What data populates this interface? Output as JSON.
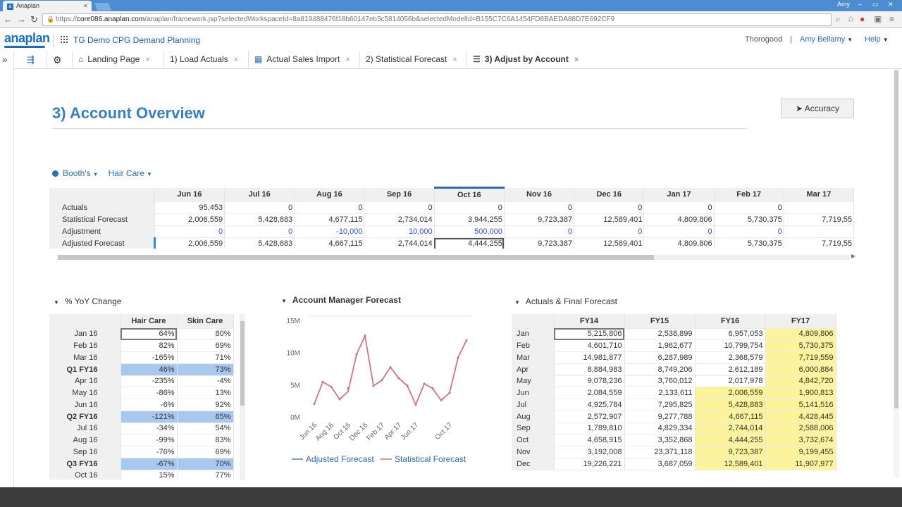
{
  "browser": {
    "tab_title": "Anaplan",
    "tab_close": "×",
    "user": "Amy",
    "win_min": "–",
    "win_max": "▭",
    "win_close": "✕",
    "url_scheme": "https://",
    "url_host": "core086.anaplan.com",
    "url_rest": "/anaplan/framework.jsp?selectedWorkspaceId=8a819488476f18b60147eb3c5814056b&selectedModelId=B155C7C6A1454FD8BAEDA88D7E692CF9"
  },
  "app": {
    "logo": "anaplan",
    "model_name": "TG Demo CPG Demand Planning",
    "workspace": "Thorogood",
    "separator": "|",
    "user": "Amy Bellamy",
    "help": "Help",
    "side_toggle": "»"
  },
  "tabs": [
    {
      "label": "Landing Page",
      "close": "×"
    },
    {
      "label": "1) Load Actuals",
      "close": "×"
    },
    {
      "label": "Actual Sales Import",
      "close": "×"
    },
    {
      "label": "2) Statistical Forecast",
      "close": "×"
    },
    {
      "label": "3) Adjust by Account",
      "close": "×"
    }
  ],
  "page": {
    "title": "3) Account Overview",
    "accuracy_button": "Accuracy"
  },
  "filters": {
    "account": "Booth's",
    "category": "Hair Care"
  },
  "main_grid": {
    "columns": [
      "Jun 16",
      "Jul 16",
      "Aug 16",
      "Sep 16",
      "Oct 16",
      "Nov 16",
      "Dec 16",
      "Jan 17",
      "Feb 17",
      "Mar 17"
    ],
    "rows": [
      {
        "label": "Actuals",
        "values": [
          "95,453",
          "0",
          "0",
          "0",
          "0",
          "0",
          "0",
          "0",
          "0",
          ""
        ]
      },
      {
        "label": "Statistical Forecast",
        "values": [
          "2,006,559",
          "5,428,883",
          "4,677,115",
          "2,734,014",
          "3,944,255",
          "9,723,387",
          "12,589,401",
          "4,809,806",
          "5,730,375",
          "7,719,55"
        ]
      },
      {
        "label": "Adjustment",
        "values": [
          "0",
          "0",
          "-10,000",
          "10,000",
          "500,000",
          "0",
          "0",
          "0",
          "0",
          ""
        ]
      },
      {
        "label": "Adjusted Forecast",
        "values": [
          "2,006,559",
          "5,428,883",
          "4,667,115",
          "2,744,014",
          "4,444,255",
          "9,723,387",
          "12,589,401",
          "4,809,806",
          "5,730,375",
          "7,719,55"
        ]
      }
    ]
  },
  "yoy": {
    "title": "% YoY Change",
    "columns": [
      "Hair Care",
      "Skin Care"
    ],
    "rows": [
      {
        "label": "Jan 16",
        "values": [
          "64%",
          "80%"
        ],
        "q": false
      },
      {
        "label": "Feb 16",
        "values": [
          "82%",
          "69%"
        ],
        "q": false
      },
      {
        "label": "Mar 16",
        "values": [
          "-165%",
          "71%"
        ],
        "q": false
      },
      {
        "label": "Q1 FY16",
        "values": [
          "46%",
          "73%"
        ],
        "q": true
      },
      {
        "label": "Apr 16",
        "values": [
          "-235%",
          "-4%"
        ],
        "q": false
      },
      {
        "label": "May 16",
        "values": [
          "-86%",
          "13%"
        ],
        "q": false
      },
      {
        "label": "Jun 16",
        "values": [
          "-6%",
          "92%"
        ],
        "q": false
      },
      {
        "label": "Q2 FY16",
        "values": [
          "-121%",
          "65%"
        ],
        "q": true
      },
      {
        "label": "Jul 16",
        "values": [
          "-34%",
          "54%"
        ],
        "q": false
      },
      {
        "label": "Aug 16",
        "values": [
          "-99%",
          "83%"
        ],
        "q": false
      },
      {
        "label": "Sep 16",
        "values": [
          "-76%",
          "69%"
        ],
        "q": false
      },
      {
        "label": "Q3 FY16",
        "values": [
          "-67%",
          "70%"
        ],
        "q": true
      },
      {
        "label": "Oct 16",
        "values": [
          "15%",
          "77%"
        ],
        "q": false
      }
    ]
  },
  "chart_title": "Account Manager Forecast",
  "chart_data": {
    "type": "line",
    "title": "Account Manager Forecast",
    "x": [
      "Jun 16",
      "Jul 16",
      "Aug 16",
      "Sep 16",
      "Oct 16",
      "Nov 16",
      "Dec 16",
      "Jan 17",
      "Feb 17",
      "Mar 17",
      "Apr 17",
      "May 17",
      "Jun 17",
      "Jul 17",
      "Aug 17",
      "Sep 17",
      "Oct 17",
      "Nov 17",
      "Dec 17"
    ],
    "x_tick_labels": [
      "Jun 16",
      "Aug 16",
      "Oct 16",
      "Dec 16",
      "Feb 17",
      "Apr 17",
      "Jun 17",
      "Oct 17"
    ],
    "y_tick_labels": [
      "15M",
      "10M",
      "5M",
      "0M"
    ],
    "ylim": [
      0,
      15000000
    ],
    "series": [
      {
        "name": "Adjusted Forecast",
        "color": "#5b7fb4",
        "values": [
          2006559,
          5428883,
          4667115,
          2744014,
          4444255,
          9723387,
          12589401,
          4809806,
          5730375,
          7719559,
          6000884,
          4842720,
          1900813,
          5141516,
          4428445,
          2588006,
          3732674,
          9199455,
          11907977
        ],
        "line": false
      },
      {
        "name": "Statistical Forecast",
        "color": "#d0767e",
        "values": [
          2006559,
          5428883,
          4677115,
          2734014,
          3944255,
          9723387,
          12589401,
          4809806,
          5730375,
          7719559,
          6000884,
          4842720,
          1900813,
          5141516,
          4428445,
          2588006,
          3732674,
          9199455,
          11907977
        ],
        "line": true
      }
    ]
  },
  "af": {
    "title": "Actuals & Final Forecast",
    "columns": [
      "FY14",
      "FY15",
      "FY16",
      "FY17"
    ],
    "rows": [
      {
        "label": "Jan",
        "values": [
          "5,215,806",
          "2,538,899",
          "6,957,053",
          "4,809,806"
        ],
        "yel": [
          false,
          false,
          false,
          true
        ]
      },
      {
        "label": "Feb",
        "values": [
          "4,601,710",
          "1,962,677",
          "10,799,754",
          "5,730,375"
        ],
        "yel": [
          false,
          false,
          false,
          true
        ]
      },
      {
        "label": "Mar",
        "values": [
          "14,981,877",
          "6,287,989",
          "2,368,579",
          "7,719,559"
        ],
        "yel": [
          false,
          false,
          false,
          true
        ]
      },
      {
        "label": "Apr",
        "values": [
          "8,884,983",
          "8,749,206",
          "2,612,189",
          "6,000,884"
        ],
        "yel": [
          false,
          false,
          false,
          true
        ]
      },
      {
        "label": "May",
        "values": [
          "9,078,236",
          "3,760,012",
          "2,017,978",
          "4,842,720"
        ],
        "yel": [
          false,
          false,
          false,
          true
        ]
      },
      {
        "label": "Jun",
        "values": [
          "2,084,559",
          "2,133,611",
          "2,006,559",
          "1,900,813"
        ],
        "yel": [
          false,
          false,
          true,
          true
        ]
      },
      {
        "label": "Jul",
        "values": [
          "4,925,784",
          "7,295,825",
          "5,428,883",
          "5,141,516"
        ],
        "yel": [
          false,
          false,
          true,
          true
        ]
      },
      {
        "label": "Aug",
        "values": [
          "2,572,907",
          "9,277,788",
          "4,667,115",
          "4,428,445"
        ],
        "yel": [
          false,
          false,
          true,
          true
        ]
      },
      {
        "label": "Sep",
        "values": [
          "1,789,810",
          "4,829,334",
          "2,744,014",
          "2,588,006"
        ],
        "yel": [
          false,
          false,
          true,
          true
        ]
      },
      {
        "label": "Oct",
        "values": [
          "4,658,915",
          "3,352,868",
          "4,444,255",
          "3,732,674"
        ],
        "yel": [
          false,
          false,
          true,
          true
        ]
      },
      {
        "label": "Nov",
        "values": [
          "3,192,008",
          "23,371,118",
          "9,723,387",
          "9,199,455"
        ],
        "yel": [
          false,
          false,
          true,
          true
        ]
      },
      {
        "label": "Dec",
        "values": [
          "19,226,221",
          "3,687,059",
          "12,589,401",
          "11,907,977"
        ],
        "yel": [
          false,
          false,
          true,
          true
        ]
      }
    ]
  },
  "colors": {
    "accent": "#2a6ebb",
    "quarter_highlight": "#a8c8f0",
    "forecast_highlight": "#fbf49a"
  }
}
